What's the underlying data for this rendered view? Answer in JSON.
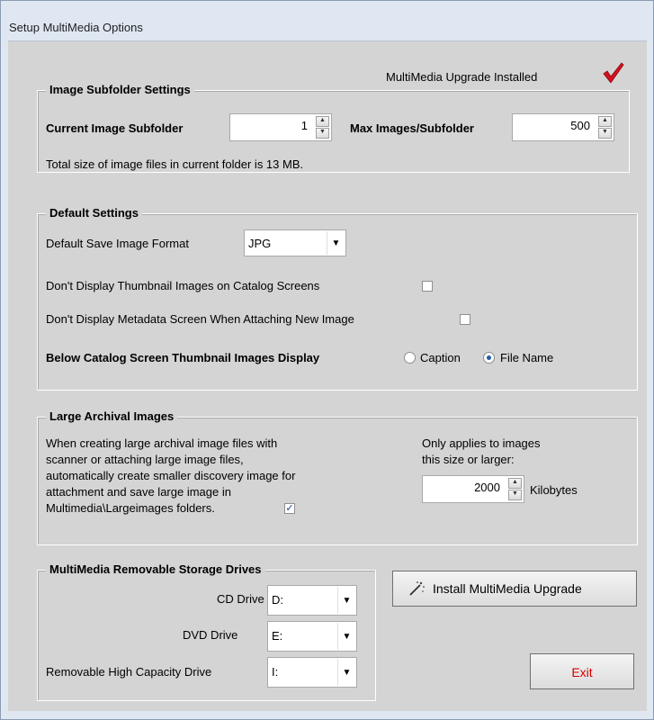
{
  "window": {
    "title": "Setup MultiMedia Options"
  },
  "status": {
    "upgrade_installed": "MultiMedia Upgrade Installed",
    "check_icon": "checkmark-icon",
    "check_color": "#d4101e"
  },
  "image_subfolder": {
    "legend": "Image Subfolder Settings",
    "current_label": "Current Image Subfolder",
    "current_value": "1",
    "max_label": "Max Images/Subfolder",
    "max_value": "500",
    "total_size_text": "Total size of image files in current folder is 13 MB."
  },
  "default_settings": {
    "legend": "Default Settings",
    "save_format_label": "Default Save Image Format",
    "save_format_value": "JPG",
    "no_thumbnails_label": "Don't Display Thumbnail Images on Catalog Screens",
    "no_thumbnails_checked": false,
    "no_metadata_label": "Don't Display Metadata Screen When Attaching New Image",
    "no_metadata_checked": false,
    "thumb_display_label": "Below Catalog Screen Thumbnail Images Display",
    "option_caption": "Caption",
    "option_filename": "File Name",
    "selected_option": "File Name"
  },
  "large_archival": {
    "legend": "Large Archival Images",
    "description_lines": [
      "When creating large archival image files with",
      "scanner or attaching large image files,",
      "automatically create smaller discovery image for",
      "attachment and save large image in",
      "Multimedia\\Largeimages folders."
    ],
    "enabled_checked": true,
    "applies_line1": "Only applies to images",
    "applies_line2": "this size or larger:",
    "size_value": "2000",
    "size_unit": "Kilobytes"
  },
  "drives": {
    "legend": "MultiMedia Removable Storage Drives",
    "cd_label": "CD Drive",
    "cd_value": "D:",
    "dvd_label": "DVD Drive",
    "dvd_value": "E:",
    "removable_label": "Removable High Capacity Drive",
    "removable_value": "I:"
  },
  "buttons": {
    "install_label": "Install MultiMedia Upgrade",
    "exit_label": "Exit",
    "exit_color": "#d40000"
  }
}
